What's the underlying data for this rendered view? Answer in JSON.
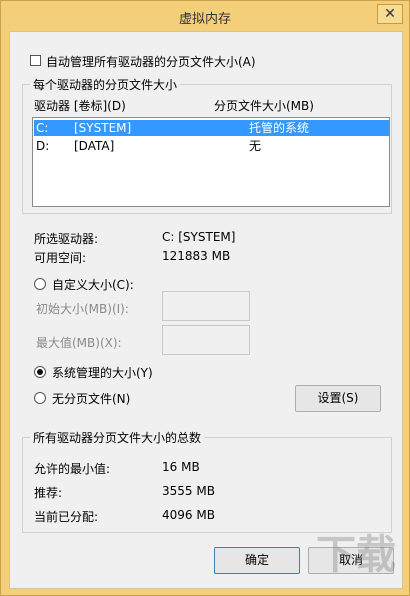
{
  "window": {
    "title": "虚拟内存",
    "close_glyph": "✕"
  },
  "auto_manage": {
    "label": "自动管理所有驱动器的分页文件大小(A)",
    "checked": false
  },
  "per_drive": {
    "group_title": "每个驱动器的分页文件大小",
    "col_drive": "驱动器 [卷标](D)",
    "col_size": "分页文件大小(MB)",
    "rows": [
      {
        "drive": "C:",
        "label": "[SYSTEM]",
        "size": "托管的系统",
        "selected": true
      },
      {
        "drive": "D:",
        "label": "[DATA]",
        "size": "无",
        "selected": false
      }
    ]
  },
  "selected_info": {
    "drive_label": "所选驱动器:",
    "drive_value": "C:  [SYSTEM]",
    "free_label": "可用空间:",
    "free_value": "121883 MB"
  },
  "options": {
    "custom_label": "自定义大小(C):",
    "initial_label": "初始大小(MB)(I):",
    "max_label": "最大值(MB)(X):",
    "system_label": "系统管理的大小(Y)",
    "none_label": "无分页文件(N)",
    "set_button": "设置(S)",
    "selected": "system"
  },
  "totals": {
    "group_title": "所有驱动器分页文件大小的总数",
    "min_label": "允许的最小值:",
    "min_value": "16 MB",
    "rec_label": "推荐:",
    "rec_value": "3555 MB",
    "cur_label": "当前已分配:",
    "cur_value": "4096 MB"
  },
  "buttons": {
    "ok": "确定",
    "cancel": "取消"
  },
  "watermark": "下载"
}
